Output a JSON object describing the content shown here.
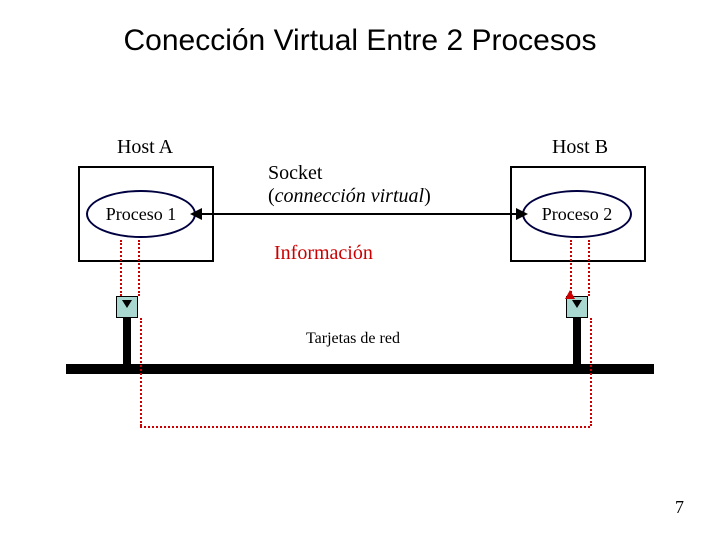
{
  "title": "Conección Virtual Entre 2 Procesos",
  "hosts": {
    "a": {
      "label": "Host A",
      "process": "Proceso 1"
    },
    "b": {
      "label": "Host B",
      "process": "Proceso 2"
    }
  },
  "socket": {
    "line1": "Socket",
    "line2_open": "(",
    "line2_italic": "connección virtual",
    "line2_close": ")"
  },
  "info_label": "Información",
  "nic_caption": "Tarjetas de red",
  "page_number": "7"
}
